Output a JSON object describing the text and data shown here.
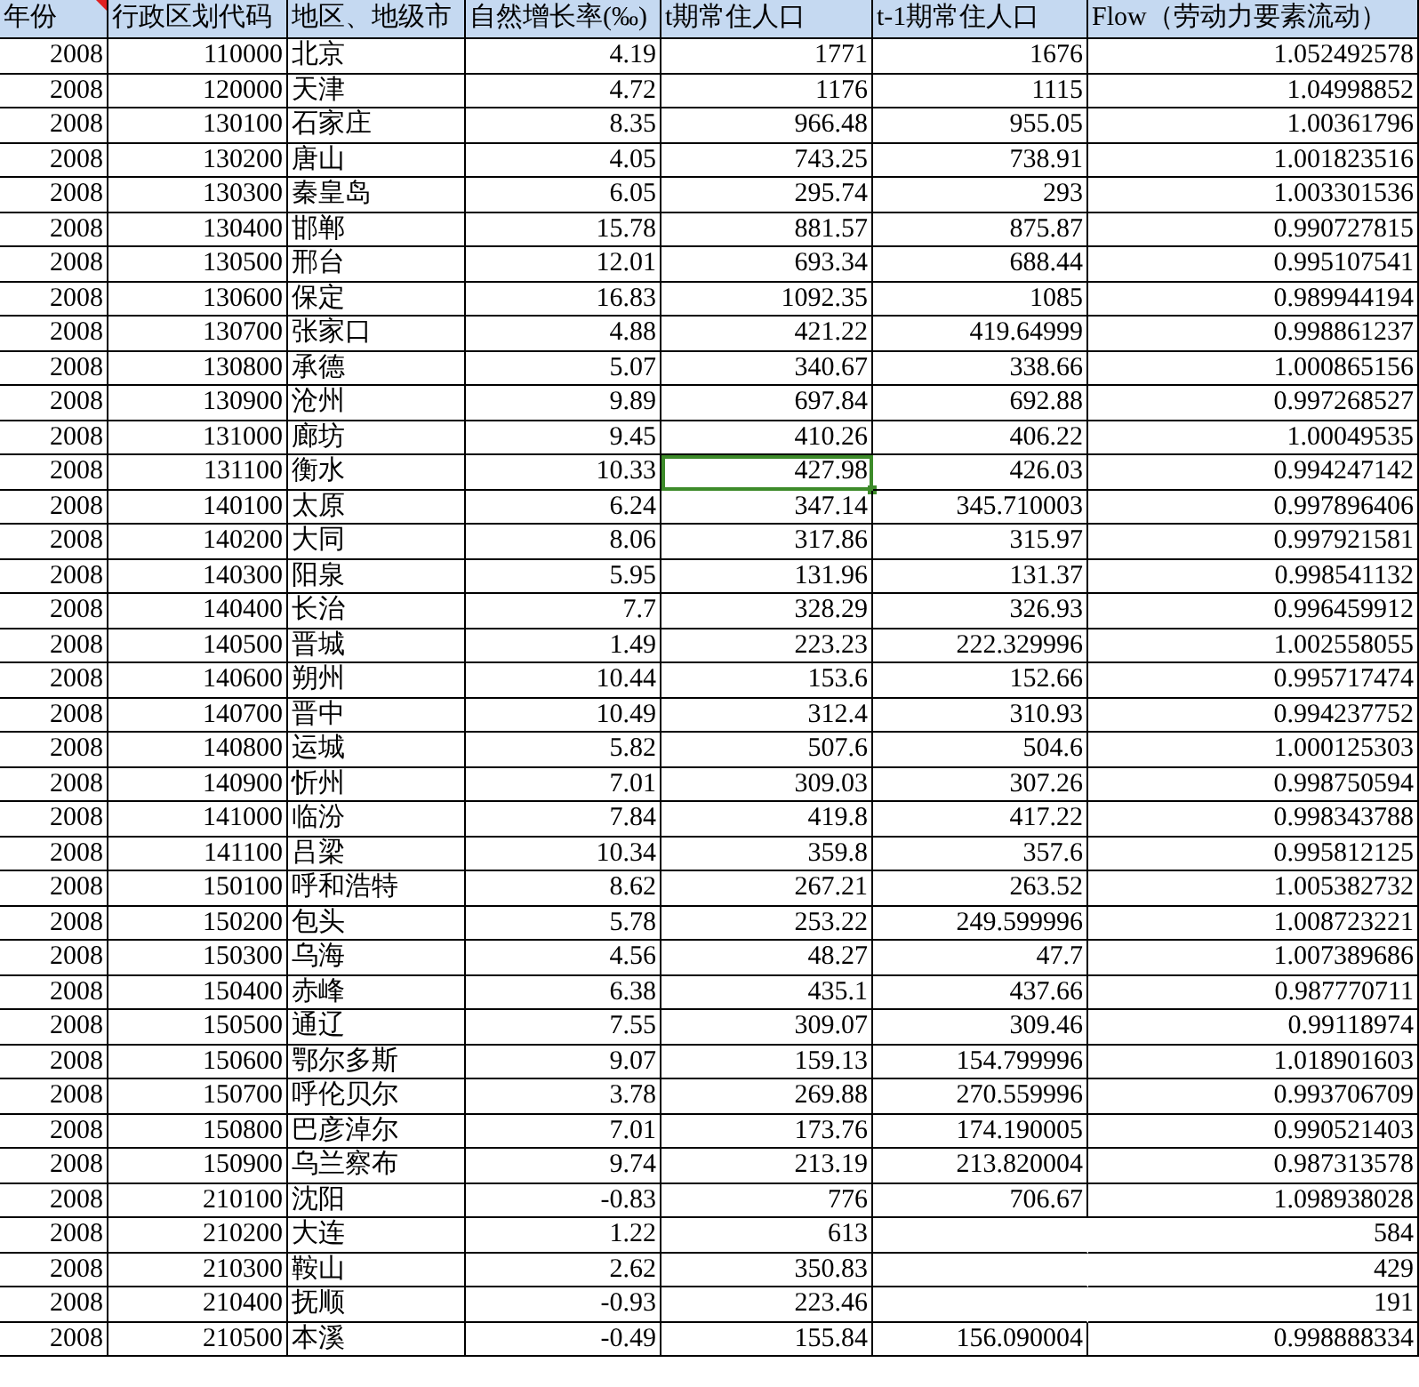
{
  "columns": [
    {
      "label": "年份",
      "commented": true
    },
    {
      "label": "行政区划代码",
      "commented": false
    },
    {
      "label": "地区、地级市",
      "commented": false
    },
    {
      "label": "自然增长率(‰)",
      "commented": false
    },
    {
      "label": "t期常住人口",
      "commented": false
    },
    {
      "label": "t-1期常住人口",
      "commented": false
    },
    {
      "label": "Flow（劳动力要素流动）",
      "commented": false
    }
  ],
  "rows": [
    {
      "year": "2008",
      "code": "110000",
      "region": "北京",
      "rate": "4.19",
      "t_pop": "1771",
      "t1_pop": "1676",
      "flow": "1.052492578",
      "selected": false
    },
    {
      "year": "2008",
      "code": "120000",
      "region": "天津",
      "rate": "4.72",
      "t_pop": "1176",
      "t1_pop": "1115",
      "flow": "1.04998852",
      "selected": false
    },
    {
      "year": "2008",
      "code": "130100",
      "region": "石家庄",
      "rate": "8.35",
      "t_pop": "966.48",
      "t1_pop": "955.05",
      "flow": "1.00361796",
      "selected": false
    },
    {
      "year": "2008",
      "code": "130200",
      "region": "唐山",
      "rate": "4.05",
      "t_pop": "743.25",
      "t1_pop": "738.91",
      "flow": "1.001823516",
      "selected": false
    },
    {
      "year": "2008",
      "code": "130300",
      "region": "秦皇岛",
      "rate": "6.05",
      "t_pop": "295.74",
      "t1_pop": "293",
      "flow": "1.003301536",
      "selected": false
    },
    {
      "year": "2008",
      "code": "130400",
      "region": "邯郸",
      "rate": "15.78",
      "t_pop": "881.57",
      "t1_pop": "875.87",
      "flow": "0.990727815",
      "selected": false
    },
    {
      "year": "2008",
      "code": "130500",
      "region": "邢台",
      "rate": "12.01",
      "t_pop": "693.34",
      "t1_pop": "688.44",
      "flow": "0.995107541",
      "selected": false
    },
    {
      "year": "2008",
      "code": "130600",
      "region": "保定",
      "rate": "16.83",
      "t_pop": "1092.35",
      "t1_pop": "1085",
      "flow": "0.989944194",
      "selected": false
    },
    {
      "year": "2008",
      "code": "130700",
      "region": "张家口",
      "rate": "4.88",
      "t_pop": "421.22",
      "t1_pop": "419.64999",
      "flow": "0.998861237",
      "selected": false
    },
    {
      "year": "2008",
      "code": "130800",
      "region": "承德",
      "rate": "5.07",
      "t_pop": "340.67",
      "t1_pop": "338.66",
      "flow": "1.000865156",
      "selected": false
    },
    {
      "year": "2008",
      "code": "130900",
      "region": "沧州",
      "rate": "9.89",
      "t_pop": "697.84",
      "t1_pop": "692.88",
      "flow": "0.997268527",
      "selected": false
    },
    {
      "year": "2008",
      "code": "131000",
      "region": "廊坊",
      "rate": "9.45",
      "t_pop": "410.26",
      "t1_pop": "406.22",
      "flow": "1.00049535",
      "selected": false
    },
    {
      "year": "2008",
      "code": "131100",
      "region": "衡水",
      "rate": "10.33",
      "t_pop": "427.98",
      "t1_pop": "426.03",
      "flow": "0.994247142",
      "selected": true
    },
    {
      "year": "2008",
      "code": "140100",
      "region": "太原",
      "rate": "6.24",
      "t_pop": "347.14",
      "t1_pop": "345.710003",
      "flow": "0.997896406",
      "selected": false
    },
    {
      "year": "2008",
      "code": "140200",
      "region": "大同",
      "rate": "8.06",
      "t_pop": "317.86",
      "t1_pop": "315.97",
      "flow": "0.997921581",
      "selected": false
    },
    {
      "year": "2008",
      "code": "140300",
      "region": "阳泉",
      "rate": "5.95",
      "t_pop": "131.96",
      "t1_pop": "131.37",
      "flow": "0.998541132",
      "selected": false
    },
    {
      "year": "2008",
      "code": "140400",
      "region": "长治",
      "rate": "7.7",
      "t_pop": "328.29",
      "t1_pop": "326.93",
      "flow": "0.996459912",
      "selected": false
    },
    {
      "year": "2008",
      "code": "140500",
      "region": "晋城",
      "rate": "1.49",
      "t_pop": "223.23",
      "t1_pop": "222.329996",
      "flow": "1.002558055",
      "selected": false
    },
    {
      "year": "2008",
      "code": "140600",
      "region": "朔州",
      "rate": "10.44",
      "t_pop": "153.6",
      "t1_pop": "152.66",
      "flow": "0.995717474",
      "selected": false
    },
    {
      "year": "2008",
      "code": "140700",
      "region": "晋中",
      "rate": "10.49",
      "t_pop": "312.4",
      "t1_pop": "310.93",
      "flow": "0.994237752",
      "selected": false
    },
    {
      "year": "2008",
      "code": "140800",
      "region": "运城",
      "rate": "5.82",
      "t_pop": "507.6",
      "t1_pop": "504.6",
      "flow": "1.000125303",
      "selected": false
    },
    {
      "year": "2008",
      "code": "140900",
      "region": "忻州",
      "rate": "7.01",
      "t_pop": "309.03",
      "t1_pop": "307.26",
      "flow": "0.998750594",
      "selected": false
    },
    {
      "year": "2008",
      "code": "141000",
      "region": "临汾",
      "rate": "7.84",
      "t_pop": "419.8",
      "t1_pop": "417.22",
      "flow": "0.998343788",
      "selected": false
    },
    {
      "year": "2008",
      "code": "141100",
      "region": "吕梁",
      "rate": "10.34",
      "t_pop": "359.8",
      "t1_pop": "357.6",
      "flow": "0.995812125",
      "selected": false
    },
    {
      "year": "2008",
      "code": "150100",
      "region": "呼和浩特",
      "rate": "8.62",
      "t_pop": "267.21",
      "t1_pop": "263.52",
      "flow": "1.005382732",
      "selected": false
    },
    {
      "year": "2008",
      "code": "150200",
      "region": "包头",
      "rate": "5.78",
      "t_pop": "253.22",
      "t1_pop": "249.599996",
      "flow": "1.008723221",
      "selected": false
    },
    {
      "year": "2008",
      "code": "150300",
      "region": "乌海",
      "rate": "4.56",
      "t_pop": "48.27",
      "t1_pop": "47.7",
      "flow": "1.007389686",
      "selected": false
    },
    {
      "year": "2008",
      "code": "150400",
      "region": "赤峰",
      "rate": "6.38",
      "t_pop": "435.1",
      "t1_pop": "437.66",
      "flow": "0.987770711",
      "selected": false
    },
    {
      "year": "2008",
      "code": "150500",
      "region": "通辽",
      "rate": "7.55",
      "t_pop": "309.07",
      "t1_pop": "309.46",
      "flow": "0.99118974",
      "selected": false
    },
    {
      "year": "2008",
      "code": "150600",
      "region": "鄂尔多斯",
      "rate": "9.07",
      "t_pop": "159.13",
      "t1_pop": "154.799996",
      "flow": "1.018901603",
      "selected": false
    },
    {
      "year": "2008",
      "code": "150700",
      "region": "呼伦贝尔",
      "rate": "3.78",
      "t_pop": "269.88",
      "t1_pop": "270.559996",
      "flow": "0.993706709",
      "selected": false
    },
    {
      "year": "2008",
      "code": "150800",
      "region": "巴彦淖尔",
      "rate": "7.01",
      "t_pop": "173.76",
      "t1_pop": "174.190005",
      "flow": "0.990521403",
      "selected": false
    },
    {
      "year": "2008",
      "code": "150900",
      "region": "乌兰察布",
      "rate": "9.74",
      "t_pop": "213.19",
      "t1_pop": "213.820004",
      "flow": "0.987313578",
      "selected": false
    },
    {
      "year": "2008",
      "code": "210100",
      "region": "沈阳",
      "rate": "-0.83",
      "t_pop": "776",
      "t1_pop": "706.67",
      "flow": "1.098938028",
      "selected": false
    },
    {
      "year": "2008",
      "code": "210200",
      "region": "大连",
      "rate": "1.22",
      "t_pop": "613",
      "flow": "584",
      "selected": false
    },
    {
      "year": "2008",
      "code": "210300",
      "region": "鞍山",
      "rate": "2.62",
      "t_pop": "350.83",
      "flow": "429",
      "selected": false
    },
    {
      "year": "2008",
      "code": "210400",
      "region": "抚顺",
      "rate": "-0.93",
      "t_pop": "223.46",
      "flow": "191",
      "selected": false
    },
    {
      "year": "2008",
      "code": "210500",
      "region": "本溪",
      "rate": "-0.49",
      "t_pop": "155.84",
      "t1_pop": "156.090004",
      "flow": "0.998888334",
      "selected": false
    }
  ]
}
